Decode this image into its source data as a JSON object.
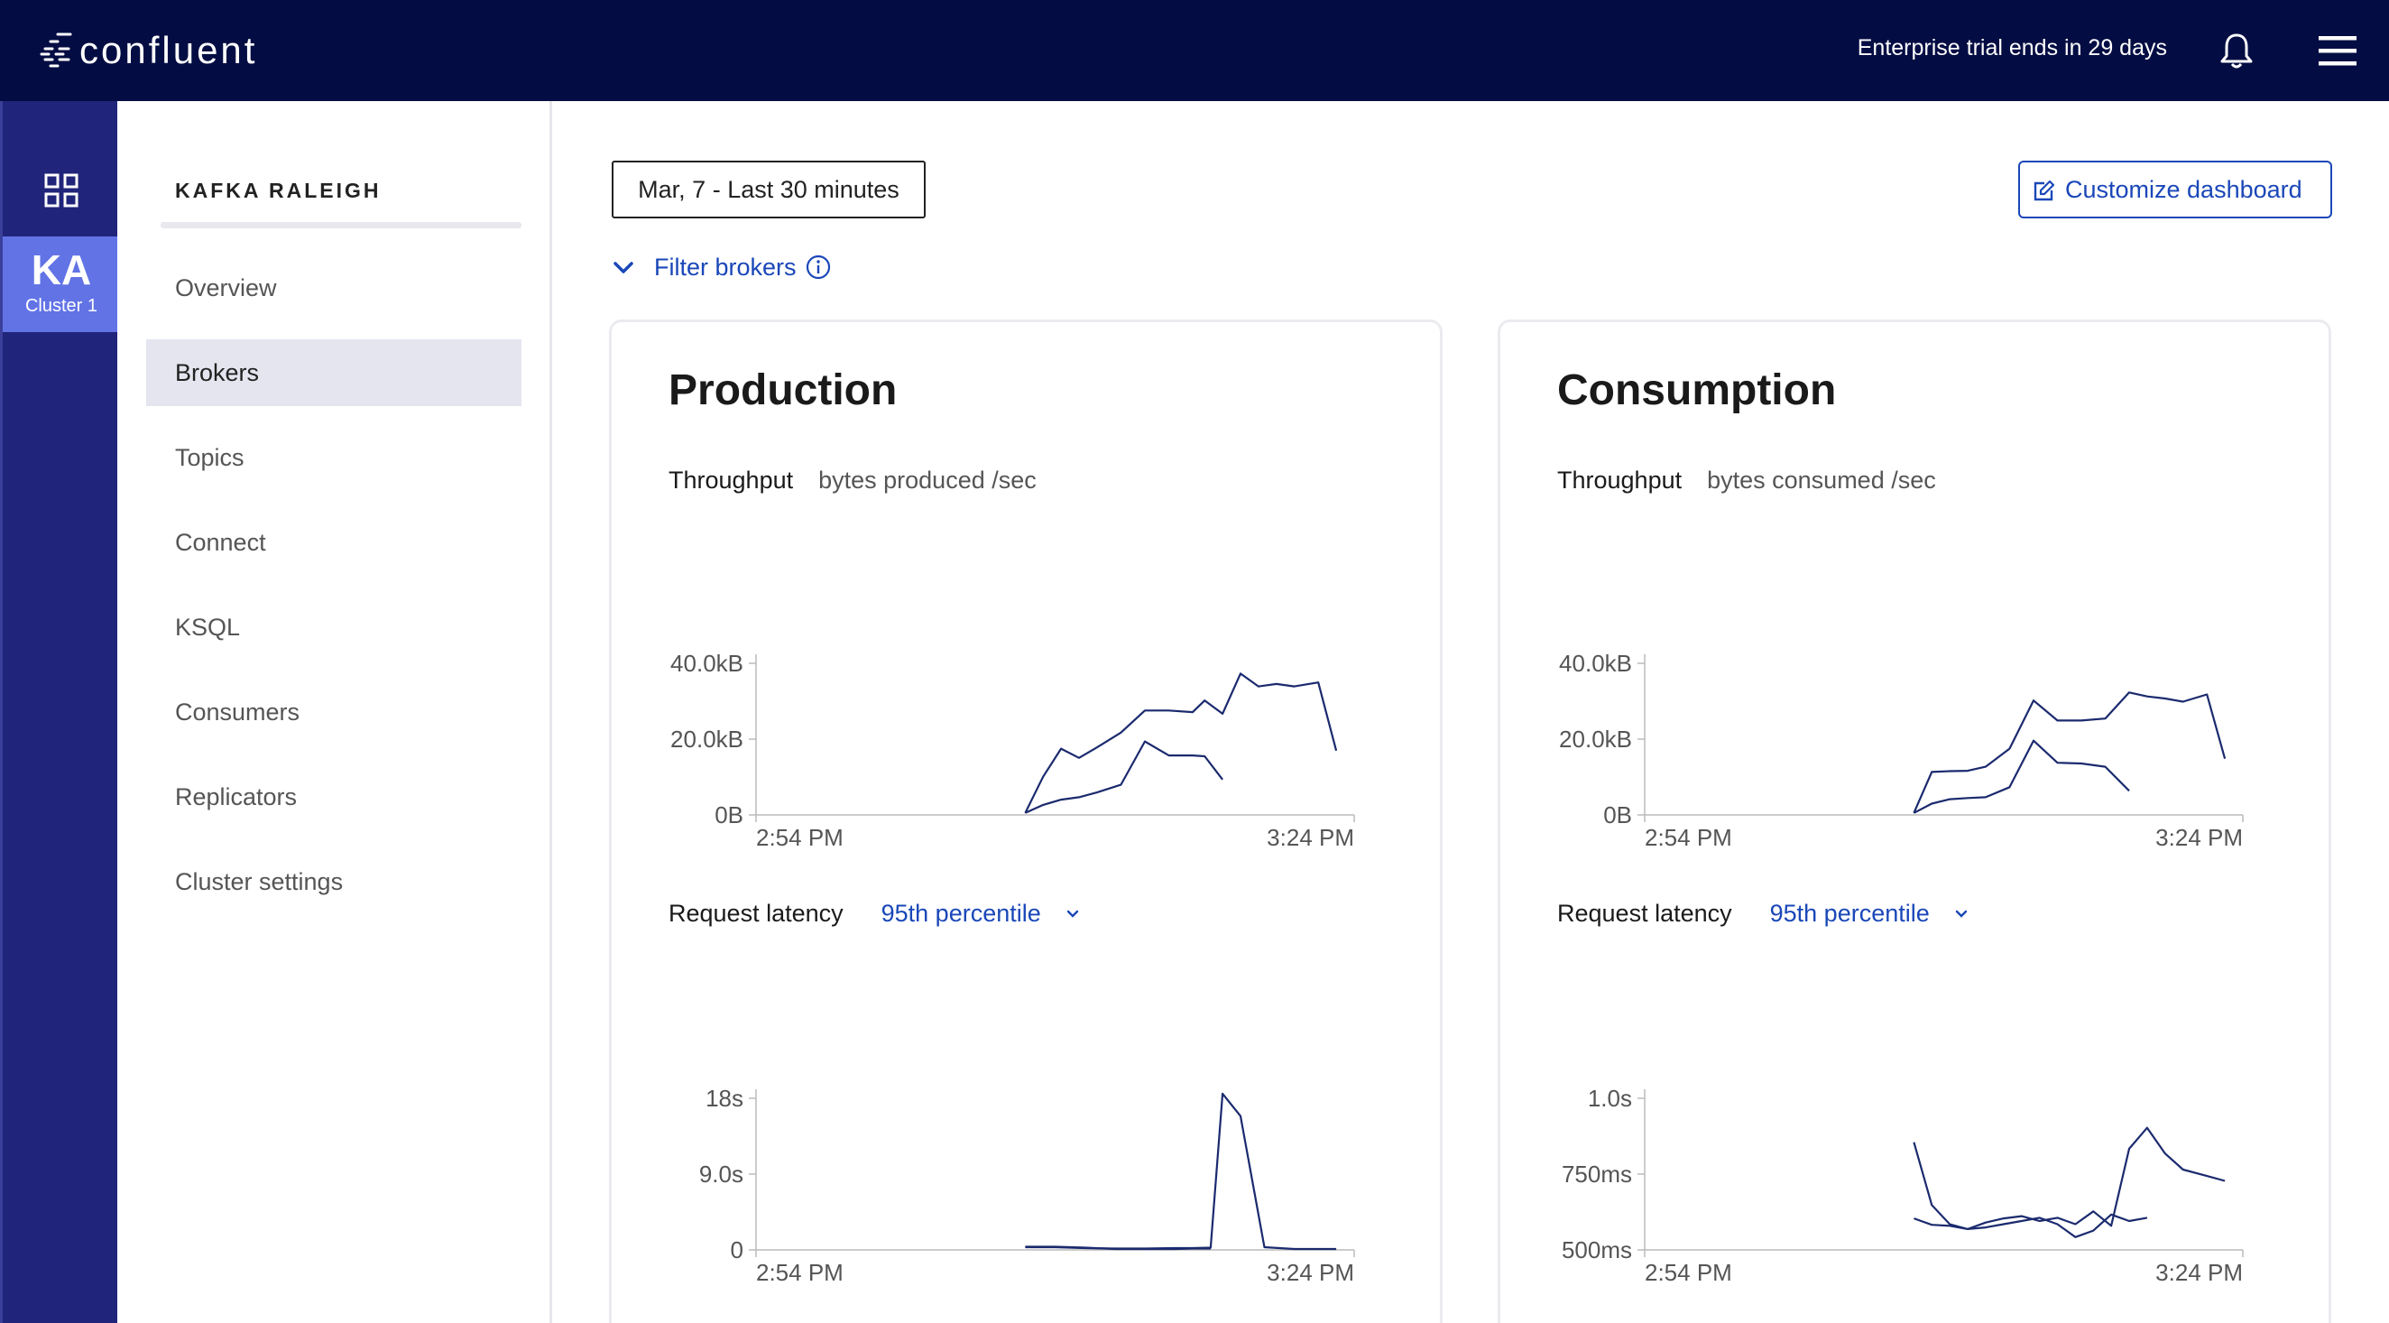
{
  "topbar": {
    "logo_text": "confluent",
    "trial_text": "Enterprise trial ends in 29 days"
  },
  "rail": {
    "cluster_abbr": "KA",
    "cluster_name": "Cluster 1"
  },
  "sidebar": {
    "title": "KAFKA RALEIGH",
    "items": [
      {
        "label": "Overview",
        "active": false
      },
      {
        "label": "Brokers",
        "active": true
      },
      {
        "label": "Topics",
        "active": false
      },
      {
        "label": "Connect",
        "active": false
      },
      {
        "label": "KSQL",
        "active": false
      },
      {
        "label": "Consumers",
        "active": false
      },
      {
        "label": "Replicators",
        "active": false
      },
      {
        "label": "Cluster settings",
        "active": false
      }
    ]
  },
  "main": {
    "date_range": "Mar, 7 - Last 30 minutes",
    "customize_label": "Customize dashboard",
    "filter_label": "Filter brokers"
  },
  "colors": {
    "topbar": "#040d43",
    "rail": "#20247a",
    "cluster_tile": "#6273e6",
    "accent": "#1a47b8",
    "line": "#1b2a6e"
  },
  "production": {
    "title": "Production",
    "throughput_label": "Throughput",
    "throughput_unit": "bytes produced /sec",
    "latency_label": "Request latency",
    "percentile": "95th percentile"
  },
  "consumption": {
    "title": "Consumption",
    "throughput_label": "Throughput",
    "throughput_unit": "bytes consumed /sec",
    "latency_label": "Request latency",
    "percentile": "95th percentile"
  },
  "chart_data": [
    {
      "id": "production-throughput",
      "type": "line",
      "x_ticks": [
        "2:54 PM",
        "3:24 PM"
      ],
      "y_ticks": [
        "40.0kB",
        "20.0kB",
        "0B"
      ],
      "ylim": [
        0,
        40
      ],
      "x": [
        0.45,
        0.48,
        0.51,
        0.54,
        0.57,
        0.61,
        0.65,
        0.69,
        0.73,
        0.75,
        0.78,
        0.81,
        0.84,
        0.87,
        0.9,
        0.94,
        0.97
      ],
      "series": [
        {
          "values": [
            0.5,
            9.5,
            16.5,
            14.2,
            16.8,
            20.5,
            26,
            26,
            25.6,
            28.5,
            25.2,
            35.2,
            32,
            32.6,
            32,
            33,
            16
          ]
        },
        {
          "values": [
            0.5,
            2.5,
            3.8,
            4.4,
            5.6,
            7.5,
            18.3,
            14.8,
            14.8,
            14.6,
            8.8,
            null,
            null,
            null,
            null,
            null,
            null
          ]
        }
      ]
    },
    {
      "id": "production-latency",
      "type": "line",
      "x_ticks": [
        "2:54 PM",
        "3:24 PM"
      ],
      "y_ticks": [
        "18s",
        "9.0s",
        "0"
      ],
      "ylim": [
        0,
        18
      ],
      "x": [
        0.45,
        0.5,
        0.55,
        0.6,
        0.65,
        0.7,
        0.73,
        0.76,
        0.78,
        0.81,
        0.85,
        0.9,
        0.97
      ],
      "series": [
        {
          "values": [
            0.3,
            0.3,
            0.2,
            0.15,
            0.15,
            0.2,
            0.2,
            0.25,
            17.5,
            15,
            0.3,
            0.1,
            0.1
          ]
        },
        {
          "values": [
            0.35,
            0.35,
            0.25,
            0.1,
            0.1,
            0.1,
            0.15,
            0.15,
            null,
            null,
            null,
            null,
            null
          ]
        }
      ]
    },
    {
      "id": "consumption-throughput",
      "type": "line",
      "x_ticks": [
        "2:54 PM",
        "3:24 PM"
      ],
      "y_ticks": [
        "40.0kB",
        "20.0kB",
        "0B"
      ],
      "ylim": [
        0,
        40
      ],
      "x": [
        0.45,
        0.48,
        0.51,
        0.54,
        0.57,
        0.61,
        0.65,
        0.69,
        0.73,
        0.77,
        0.81,
        0.84,
        0.87,
        0.9,
        0.94,
        0.97
      ],
      "series": [
        {
          "values": [
            0.5,
            10.7,
            10.9,
            11,
            12,
            16.5,
            28.5,
            23.5,
            23.5,
            24,
            30.5,
            29.5,
            29,
            28.2,
            30,
            14
          ]
        },
        {
          "values": [
            0.5,
            2.8,
            3.9,
            4.2,
            4.4,
            6.9,
            18.5,
            13,
            12.8,
            12,
            6,
            null,
            null,
            null,
            null,
            null
          ]
        }
      ]
    },
    {
      "id": "consumption-latency",
      "type": "line",
      "x_ticks": [
        "2:54 PM",
        "3:24 PM"
      ],
      "y_ticks": [
        "1.0s",
        "750ms",
        "500ms"
      ],
      "ylim": [
        500,
        1000
      ],
      "x": [
        0.45,
        0.48,
        0.51,
        0.54,
        0.57,
        0.6,
        0.63,
        0.66,
        0.69,
        0.72,
        0.75,
        0.78,
        0.81,
        0.84,
        0.87,
        0.9,
        0.94,
        0.97
      ],
      "series": [
        {
          "values": [
            835,
            640,
            580,
            565,
            585,
            598,
            605,
            590,
            600,
            580,
            620,
            575,
            815,
            880,
            800,
            750,
            730,
            715
          ]
        },
        {
          "values": [
            598,
            578,
            575,
            565,
            570,
            580,
            590,
            600,
            580,
            540,
            560,
            610,
            590,
            600,
            null,
            null,
            null,
            null
          ]
        }
      ]
    }
  ]
}
